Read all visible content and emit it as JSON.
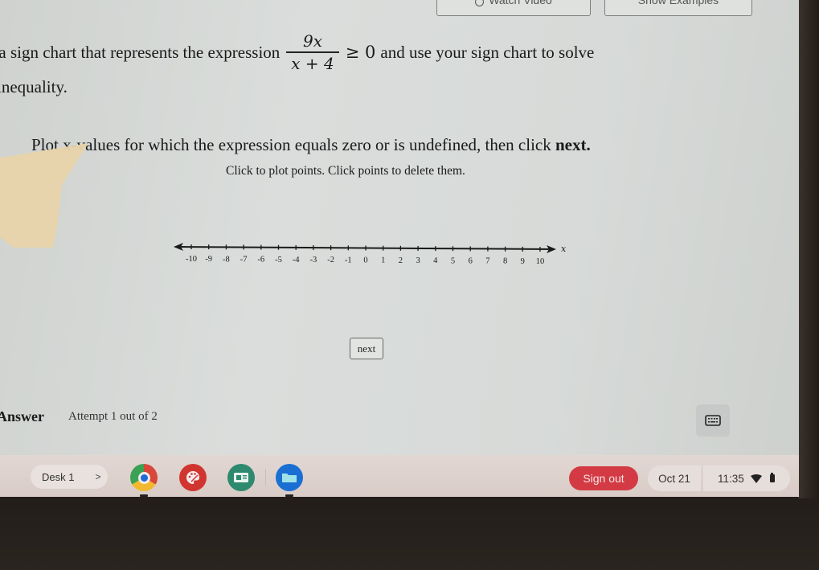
{
  "header": {
    "watch_video_label": "Watch Video",
    "show_examples_label": "Show Examples"
  },
  "question": {
    "prefix": "ake a sign chart that represents the expression",
    "numerator": "9x",
    "denominator": "x + 4",
    "relation": "≥ 0",
    "suffix": "and use your sign chart to solve",
    "line2": "inequality."
  },
  "instruction": {
    "part1": "Plot x-values for which the expression equals zero or is undefined, then click ",
    "emphasis": "next.",
    "sub": "Click to plot points. Click points to delete them."
  },
  "number_line": {
    "min": -10,
    "max": 10,
    "step": 1,
    "axis_label": "x",
    "tick_labels": [
      "-10",
      "-9",
      "-8",
      "-7",
      "-6",
      "-5",
      "-4",
      "-3",
      "-2",
      "-1",
      "0",
      "1",
      "2",
      "3",
      "4",
      "5",
      "6",
      "7",
      "8",
      "9",
      "10"
    ],
    "plotted_points": []
  },
  "actions": {
    "next_label": "next"
  },
  "answer": {
    "label": "Answer",
    "attempt": "Attempt 1 out of 2"
  },
  "shelf": {
    "desk_label": "Desk 1",
    "desk_arrow": ">",
    "apps": [
      {
        "name": "Chrome",
        "icon": "chrome-icon"
      },
      {
        "name": "Canvas",
        "icon": "palette-icon"
      },
      {
        "name": "Classroom",
        "icon": "classroom-icon"
      },
      {
        "name": "Files",
        "icon": "folder-icon"
      }
    ],
    "sign_out_label": "Sign out",
    "date": "Oct 21",
    "time": "11:35"
  }
}
